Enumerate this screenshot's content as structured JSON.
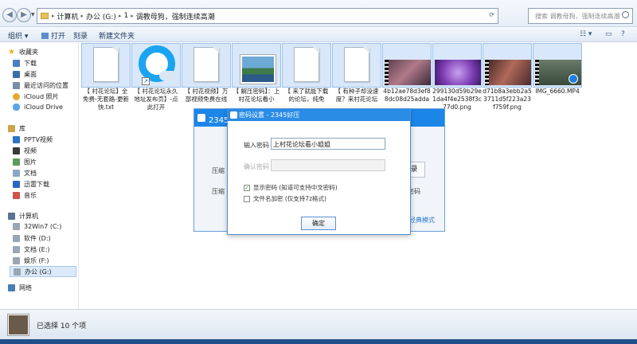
{
  "address": {
    "crumbs": [
      "计算机",
      "办公 (G:)",
      "1",
      "调教母狗，强制连续高潮"
    ],
    "search_placeholder": "搜索 调教母狗，强制连续高潮"
  },
  "toolbar": {
    "organize": "组织 ▾",
    "open": "打开",
    "burn": "刻录",
    "new_folder": "新建文件夹"
  },
  "sidebar": {
    "favorites": "收藏夹",
    "fav_items": [
      "下载",
      "桌面",
      "最近访问的位置",
      "iCloud 照片",
      "iCloud Drive"
    ],
    "libraries": "库",
    "lib_items": [
      "PPTV视频",
      "视频",
      "图片",
      "文档",
      "迅雷下载",
      "音乐"
    ],
    "computer": "计算机",
    "drives": [
      "32Win7 (C:)",
      "软件 (D:)",
      "文档 (E:)",
      "娱乐 (F:)",
      "办公 (G:)"
    ],
    "network": "网络"
  },
  "files": [
    {
      "name": "【 村花论坛】全免费-无套路-更新快.txt"
    },
    {
      "name": "【 村花论坛永久地址发布页】-点此打开"
    },
    {
      "name": "【 村花视频】万部视频免费在线"
    },
    {
      "name": "【 解压密码】：上村花论坛看小"
    },
    {
      "name": "【 来了就能下载的论坛，纯免"
    },
    {
      "name": "【 有种子却没速度？来村花论坛"
    },
    {
      "name": "4b12ae78d3ef88dc08d25adda"
    },
    {
      "name": "299130d59b29e1da4f4e2538f3c77d0.png"
    },
    {
      "name": "d71b8a3ebb2a53711d5f223a23f759f.png"
    },
    {
      "name": "IMG_6660.MP4"
    }
  ],
  "bg_dialog": {
    "title": "2345好压",
    "label_compress": "压缩",
    "label_compress2": "压缩",
    "btn": "录",
    "password_hint": "密码",
    "classic_link": "经典模式"
  },
  "dialog": {
    "title": "密码设置 - 2345好压",
    "input_label": "输入密码",
    "input_value": "上村花论坛看小姐姐",
    "confirm_label": "确认密码",
    "show_password": "显示密码 (知道可支持中文密码)",
    "encrypt_names": "文件名加密 (仅支持7z格式)",
    "ok": "确定"
  },
  "status": {
    "text": "已选择 10 个项"
  }
}
